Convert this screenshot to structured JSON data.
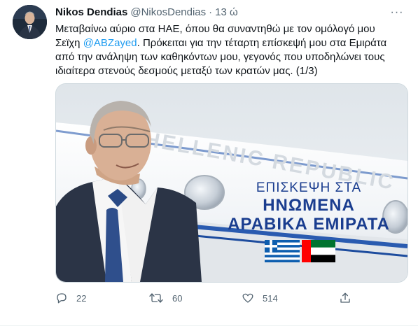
{
  "tweet": {
    "author_name": "Nikos Dendias",
    "handle": "@NikosDendias",
    "separator": "·",
    "time": "13 ώ",
    "more_label": "···",
    "text_lines": [
      "Μεταβαίνω αύριο στα ΗΑΕ, όπου θα συναντηθώ με τον ομόλογό μου",
      "Σεϊχη",
      "Πρόκειται για την τέταρτη επίσκεψή μου στα Εμιράτα",
      "από την ανάληψη των καθηκόντων μου, γεγονός που υποδηλώνει τους",
      "ιδιαίτερα στενούς δεσμούς μεταξύ των κρατών μας. (1/3)"
    ],
    "mention": "@ABZayed"
  },
  "media": {
    "plane_text": "HELLENIC REPUBLIC",
    "line1": "ΕΠΙΣΚΕΨΗ ΣΤΑ",
    "line2": "ΗΝΩΜΕΝΑ",
    "line3": "ΑΡΑΒΙΚΑ ΕΜΙΡΑΤΑ",
    "flags": [
      "greece-flag",
      "uae-flag"
    ]
  },
  "actions": {
    "replies": "22",
    "retweets": "60",
    "likes": "514"
  },
  "colors": {
    "accent": "#1d9bf0",
    "muted": "#536471",
    "text": "#0f1419",
    "headline": "#1a3d8f"
  }
}
